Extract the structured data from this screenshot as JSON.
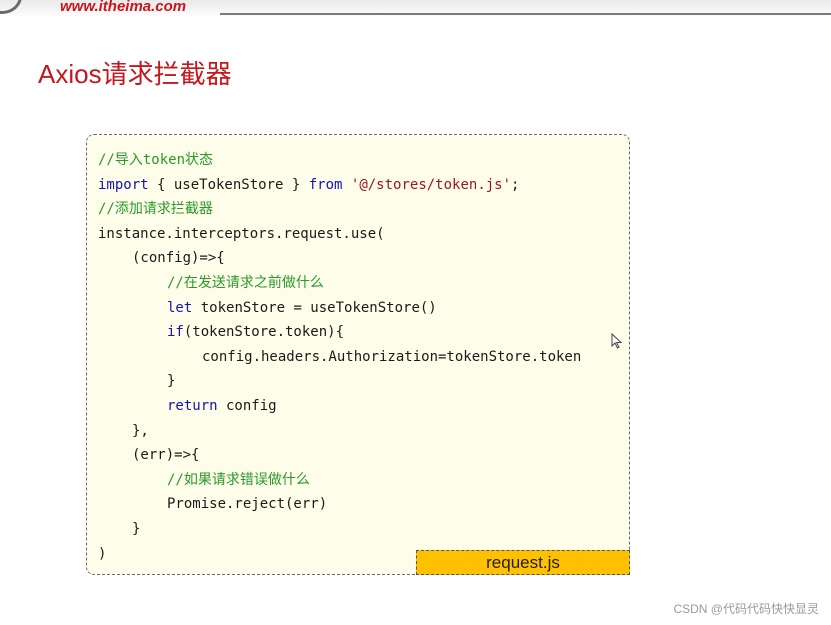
{
  "header": {
    "site_url": "www.itheima.com"
  },
  "slide": {
    "title": "Axios请求拦截器"
  },
  "code": {
    "line1": "//导入token状态",
    "line2_kw": "import",
    "line2_mid": " { useTokenStore } ",
    "line2_from": "from",
    "line2_sp": " ",
    "line2_str": "'@/stores/token.js'",
    "line2_end": ";",
    "line3": "//添加请求拦截器",
    "line4": "instance.interceptors.request.use(",
    "line5": "(config)=>{",
    "line6": "//在发送请求之前做什么",
    "line7_kw": "let",
    "line7_rest": " tokenStore = useTokenStore()",
    "line8_kw": "if",
    "line8_rest": "(tokenStore.token){",
    "line9": "config.headers.Authorization=tokenStore.token",
    "line10": "}",
    "line11_kw": "return",
    "line11_rest": " config",
    "line12": "},",
    "line13": "(err)=>{",
    "line14": "//如果请求错误做什么",
    "line15": "Promise.reject(err)",
    "line16": "}",
    "line17": ")"
  },
  "file_label": "request.js",
  "watermark": "CSDN @代码代码快快显灵",
  "colors": {
    "title_red": "#c8161d",
    "comment_green": "#2a9a2a",
    "keyword_blue": "#1313b8",
    "string_red": "#a0161b",
    "code_bg": "#fdfde9",
    "label_bg": "#ffc000"
  }
}
